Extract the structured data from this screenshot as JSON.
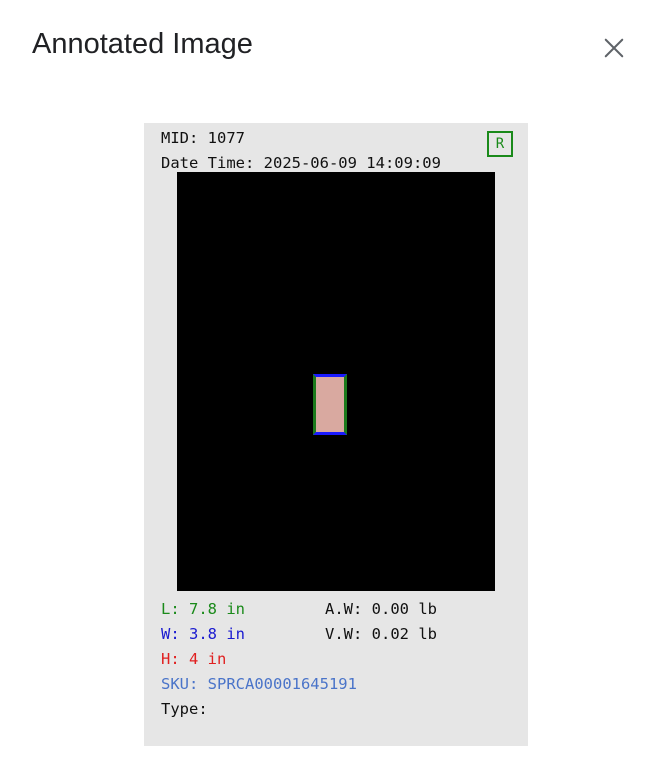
{
  "dialog": {
    "title": "Annotated Image",
    "close_icon": "close-icon"
  },
  "image": {
    "mid": "MID: 1077",
    "datetime": "Date Time: 2025-06-09 14:09:09",
    "badge": "R",
    "length": "L: 7.8 in",
    "width": "W: 3.8 in",
    "height": "H: 4 in",
    "sku": "SKU: SPRCA00001645191",
    "type": "Type:",
    "actual_weight": "A.W: 0.00 lb",
    "volumetric_weight": "V.W: 0.02 lb"
  },
  "colors": {
    "length": "#1a8a1a",
    "width": "#1a1ad0",
    "height": "#e02020",
    "sku": "#4a74c9",
    "badge": "#1a8a1a",
    "card_background": "#e6e6e6",
    "camera_background": "#000000"
  }
}
